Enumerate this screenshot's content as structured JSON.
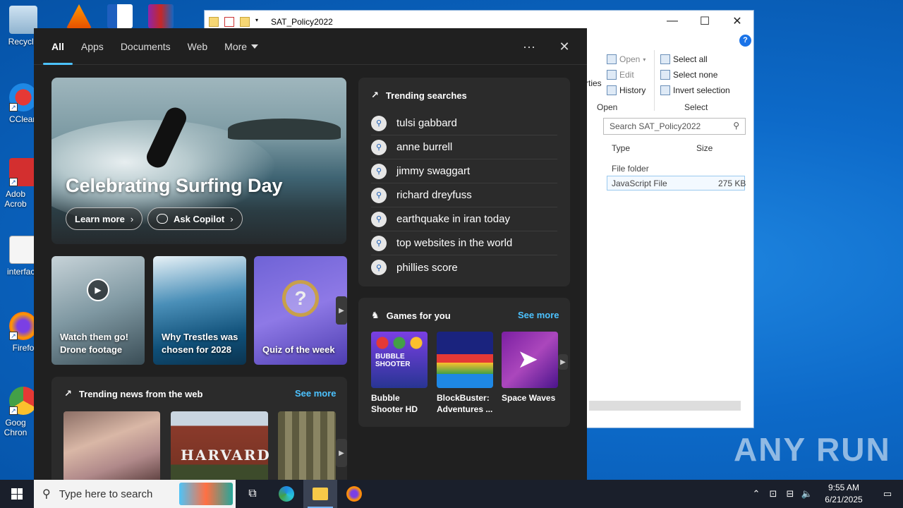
{
  "desktop": {
    "icons": [
      {
        "label": "Recycle"
      },
      {
        "label": "CClean"
      },
      {
        "label": "Adob Acrob"
      },
      {
        "label": "interface"
      },
      {
        "label": "Firefo"
      },
      {
        "label": "Goog Chron"
      }
    ],
    "watermark": "ANY RUN"
  },
  "explorer": {
    "title": "SAT_Policy2022",
    "ribbon": {
      "open": "Open",
      "edit": "Edit",
      "history": "History",
      "properties_partial": "rties",
      "open_group": "Open",
      "select_all": "Select all",
      "select_none": "Select none",
      "invert_selection": "Invert selection",
      "select_group": "Select"
    },
    "search_placeholder": "Search SAT_Policy2022",
    "columns": {
      "type": "Type",
      "size": "Size"
    },
    "rows": [
      {
        "type": "File folder",
        "size": ""
      },
      {
        "type": "JavaScript File",
        "size": "275 KB"
      }
    ]
  },
  "search_panel": {
    "tabs": [
      "All",
      "Apps",
      "Documents",
      "Web",
      "More"
    ],
    "more_options": "···",
    "close": "✕",
    "hero": {
      "title": "Celebrating Surfing Day",
      "learn_more": "Learn more",
      "ask_copilot": "Ask Copilot"
    },
    "cards": [
      {
        "label": "Watch them go! Drone footage"
      },
      {
        "label": "Why Trestles was chosen for 2028"
      },
      {
        "label": "Quiz of the week"
      }
    ],
    "trending": {
      "header": "Trending searches",
      "items": [
        "tulsi gabbard",
        "anne burrell",
        "jimmy swaggart",
        "richard dreyfuss",
        "earthquake in iran today",
        "top websites in the world",
        "phillies score"
      ]
    },
    "news": {
      "header": "Trending news from the web",
      "see_more": "See more"
    },
    "games": {
      "header": "Games for you",
      "see_more": "See more",
      "items": [
        {
          "label": "Bubble Shooter HD"
        },
        {
          "label": "BlockBuster: Adventures ..."
        },
        {
          "label": "Space Waves"
        }
      ]
    }
  },
  "taskbar": {
    "search_placeholder": "Type here to search",
    "time": "9:55 AM",
    "date": "6/21/2025"
  },
  "colors": {
    "accent": "#4cc2ff",
    "panel_bg": "#202020",
    "card_bg": "#2b2b2b",
    "desktop_bg": "#0d6ac9"
  }
}
